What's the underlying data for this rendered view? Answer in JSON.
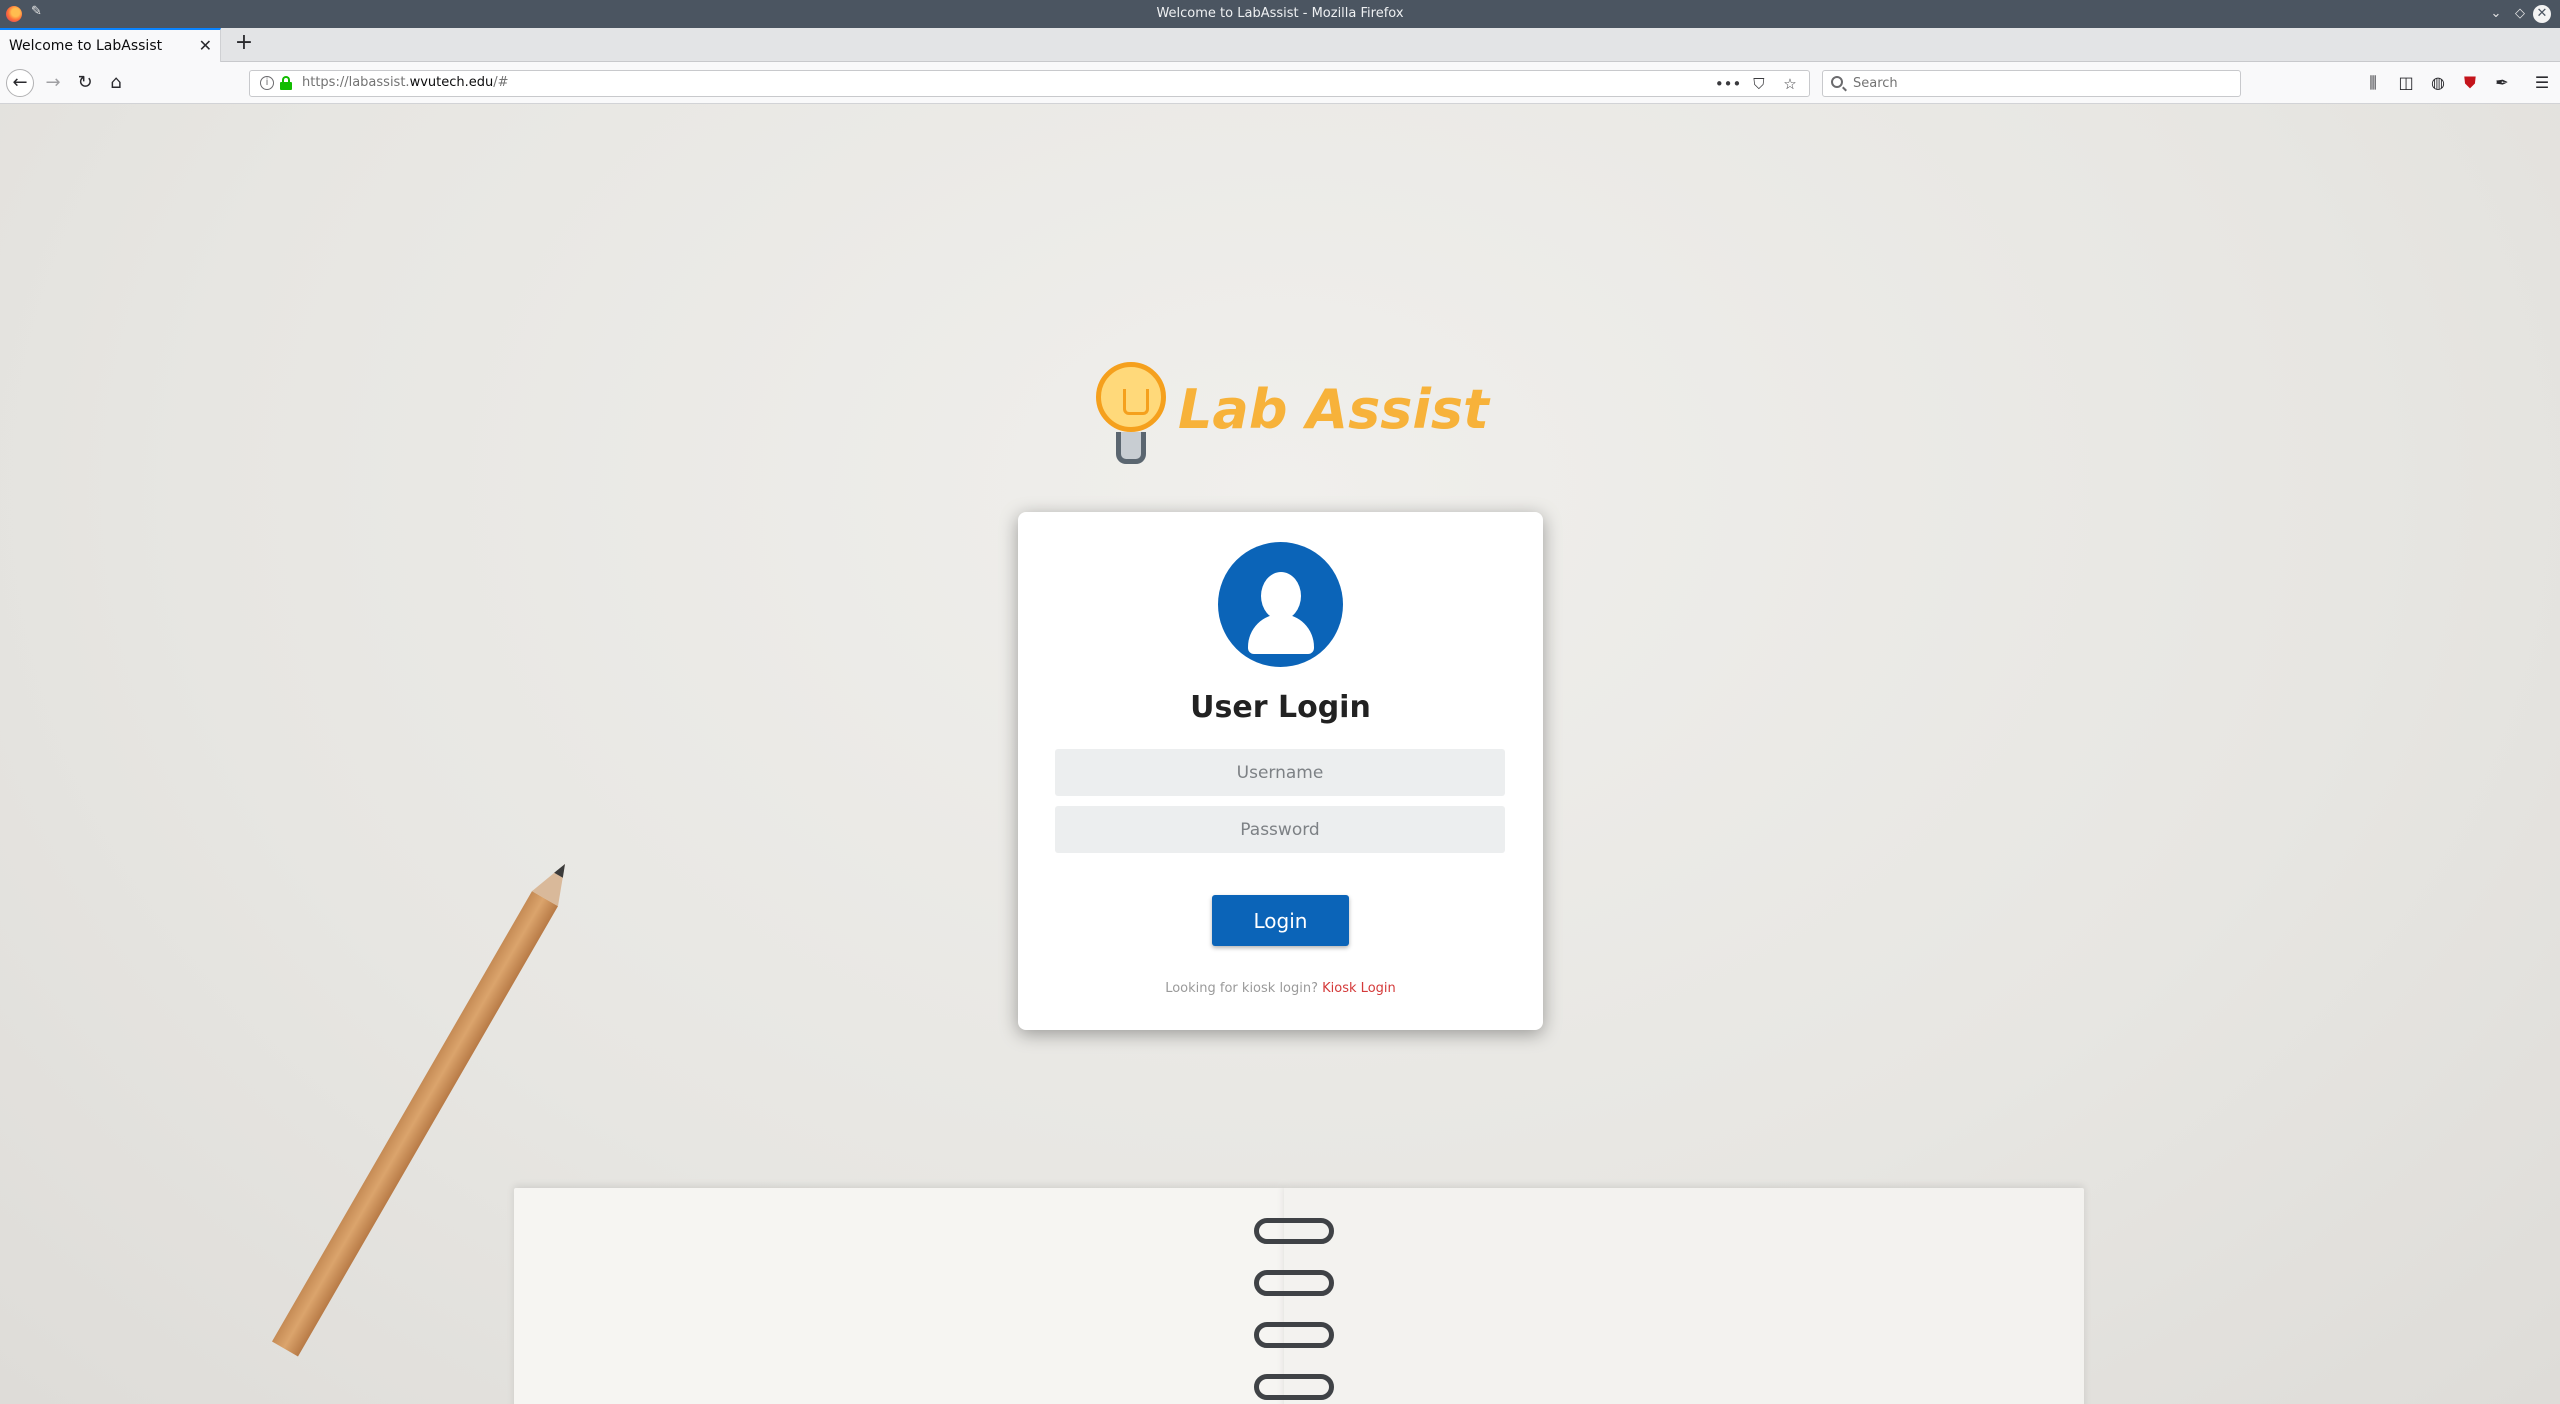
{
  "window": {
    "title": "Welcome to LabAssist - Mozilla Firefox"
  },
  "tabs": [
    {
      "label": "Welcome to LabAssist",
      "active": true
    }
  ],
  "navbar": {
    "url_prefix": "https://labassist.",
    "url_domain": "wvutech.edu",
    "url_suffix": "/#",
    "search_placeholder": "Search"
  },
  "logo": {
    "text": "Lab Assist"
  },
  "login": {
    "title": "User Login",
    "username_placeholder": "Username",
    "password_placeholder": "Password",
    "button_label": "Login",
    "kiosk_prompt": "Looking for kiosk login?",
    "kiosk_link": "Kiosk Login"
  },
  "colors": {
    "primary": "#0b64b8",
    "logo_accent": "#f7b23a",
    "link": "#d43a3a",
    "secure": "#12bc00"
  }
}
